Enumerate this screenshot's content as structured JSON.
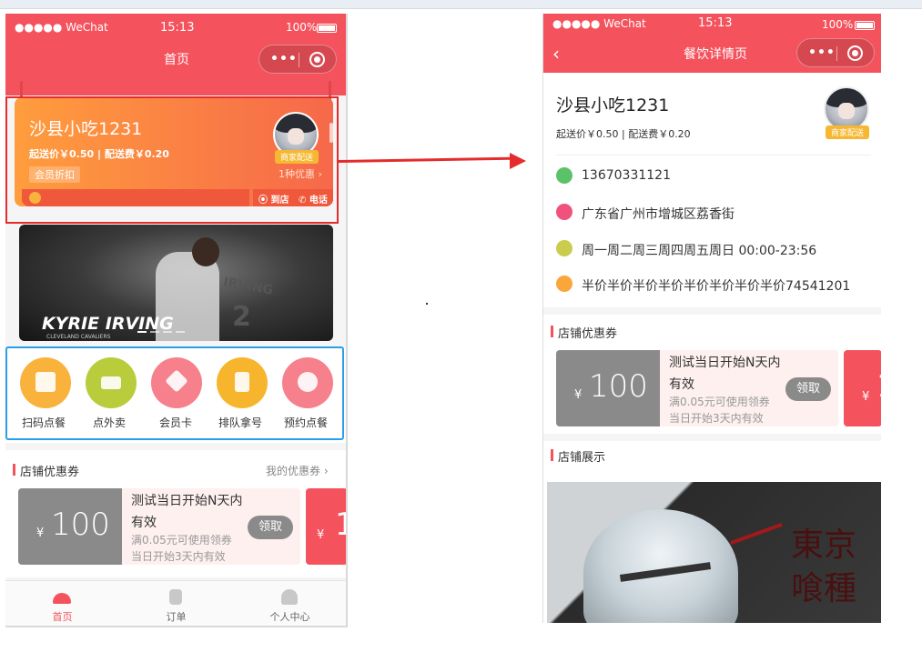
{
  "colors": {
    "primary": "#f4525c",
    "shop_gradient_start": "#ff9d3d",
    "shop_gradient_end": "#f6684a",
    "annot_red": "#e52c2c",
    "annot_blue": "#2a9fe8",
    "tag_yellow": "#f6b832"
  },
  "status": {
    "carrier": "●●●●● WeChat",
    "time": "15:13",
    "battery": "100%"
  },
  "home": {
    "nav_title": "首页",
    "shop": {
      "name": "沙县小吃1231",
      "fees": "起送价￥0.50 | 配送费￥0.20",
      "member_discount": "会员折扣",
      "delivery_tag": "商家配送",
      "promo_count": "1种优惠",
      "to_store": "到店",
      "phone": "电话"
    },
    "banner": {
      "title": "KYRIE IRVING",
      "subtitle": "CLEVELAND CAVALIERS",
      "jersey_name": "IRVING",
      "jersey_number": "2"
    },
    "quick_actions": [
      {
        "label": "扫码点餐",
        "icon": "scan-icon",
        "color": "#f9b33d"
      },
      {
        "label": "点外卖",
        "icon": "delivery-icon",
        "color": "#b9cc3b"
      },
      {
        "label": "会员卡",
        "icon": "member-card-icon",
        "color": "#f6808b"
      },
      {
        "label": "排队拿号",
        "icon": "hourglass-icon",
        "color": "#f7b52d"
      },
      {
        "label": "预约点餐",
        "icon": "clock-icon",
        "color": "#f6808b"
      }
    ],
    "coupon_section": {
      "title": "店铺优惠券",
      "more": "我的优惠券 ›"
    },
    "coupon": {
      "yen": "¥",
      "amount": "100",
      "title": "测试当日开始N天内有效",
      "condition": "满0.05元可使用领券",
      "validity": "当日开始3天内有效",
      "button": "领取"
    },
    "coupon_next": {
      "yen": "¥",
      "amount": "1"
    },
    "tabs": [
      {
        "label": "首页",
        "icon": "home-icon",
        "active": true
      },
      {
        "label": "订单",
        "icon": "order-icon",
        "active": false
      },
      {
        "label": "个人中心",
        "icon": "user-icon",
        "active": false
      }
    ]
  },
  "detail": {
    "nav_title": "餐饮详情页",
    "shop": {
      "name": "沙县小吃1231",
      "fees": "起送价￥0.50 | 配送费￥0.20",
      "delivery_tag": "商家配送"
    },
    "info": [
      {
        "icon": "phone-icon",
        "color": "#5cc26a",
        "text": "13670331121"
      },
      {
        "icon": "location-icon",
        "color": "#f0527d",
        "text": "广东省广州市增城区荔香街"
      },
      {
        "icon": "time-icon",
        "color": "#c9cc4c",
        "text": "周一周二周三周四周五周日 00:00-23:56"
      },
      {
        "icon": "notice-icon",
        "color": "#f9a63b",
        "text": "半价半价半价半价半价半价半价半价74541201"
      }
    ],
    "coupon_section": {
      "title": "店铺优惠券"
    },
    "coupon": {
      "yen": "¥",
      "amount": "100",
      "title": "测试当日开始N天内有效",
      "condition": "满0.05元可使用领券",
      "validity": "当日开始3天内有效",
      "button": "领取"
    },
    "coupon_next": {
      "yen": "¥",
      "amount": "1"
    },
    "showcase_section": {
      "title": "店铺展示"
    },
    "showcase_text_1": "東京",
    "showcase_text_2": "喰種"
  }
}
